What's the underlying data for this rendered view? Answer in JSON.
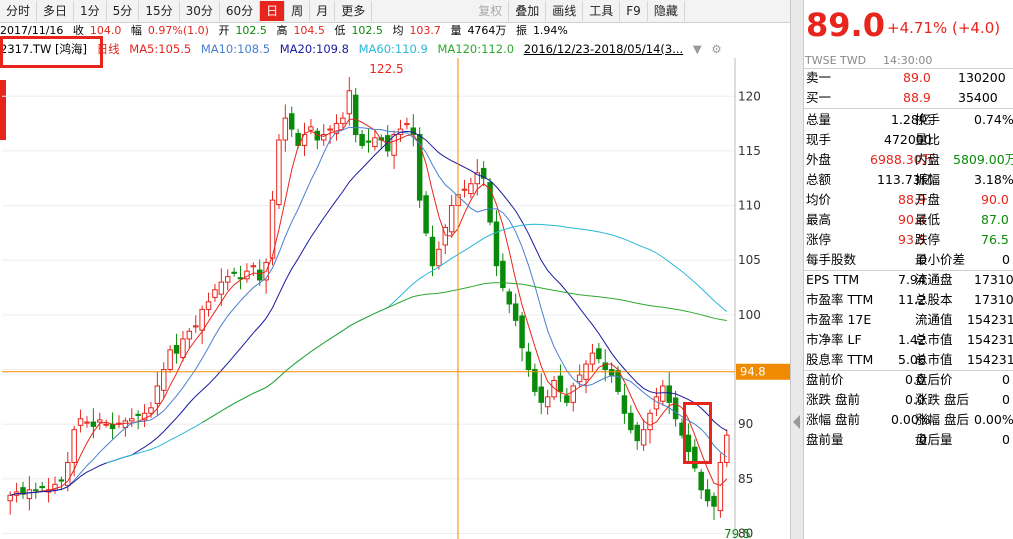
{
  "toolbar": {
    "items": [
      "分时",
      "多日",
      "1分",
      "5分",
      "15分",
      "30分",
      "60分",
      "日",
      "周",
      "月",
      "更多"
    ],
    "active": "日",
    "right": [
      "复权",
      "叠加",
      "画线",
      "工具",
      "F9",
      "隐藏"
    ]
  },
  "ohlc": {
    "date": "2017/11/16",
    "close_label": "收",
    "close": "104.0",
    "range_label": "幅",
    "range": "0.97%(1.0)",
    "open_label": "开",
    "open": "102.5",
    "high_label": "高",
    "high": "104.5",
    "low_label": "低",
    "low": "102.5",
    "avg_label": "均",
    "avg": "103.7",
    "vol_label": "量",
    "vol": "4764万",
    "amp_label": "振",
    "amp": "1.94%"
  },
  "ma_line": {
    "symbol": "2317.TW [鸿海]",
    "period": "日线",
    "ma5": "MA5:105.5",
    "ma10": "MA10:108.5",
    "ma20": "MA20:109.8",
    "ma60": "MA60:110.9",
    "ma120": "MA120:112.0",
    "date_range": "2016/12/23-2018/05/14(3..."
  },
  "chart_data": {
    "type": "candlestick",
    "yaxis_ticks": [
      80,
      85,
      90,
      95,
      100,
      105,
      110,
      115,
      120
    ],
    "ylim": [
      79.5,
      123.5
    ],
    "annotations": {
      "high_label": "122.5",
      "low_label": "79.5",
      "price_line": "94.8"
    },
    "closes": [
      83.5,
      83.8,
      83.6,
      84.0,
      83.9,
      84.2,
      84.0,
      84.5,
      84.8,
      86.5,
      89.5,
      90.5,
      90.2,
      89.8,
      90.4,
      90.0,
      89.6,
      90.1,
      90.3,
      90.5,
      90.8,
      91.0,
      91.5,
      93.5,
      95.0,
      96.8,
      96.5,
      97.8,
      98.5,
      99.0,
      100.5,
      101.2,
      102.3,
      103.0,
      103.5,
      103.8,
      103.3,
      104.0,
      104.5,
      103.2,
      104.8,
      110.5,
      116.0,
      118.0,
      117.0,
      115.5,
      116.5,
      117.2,
      116.0,
      116.5,
      117.0,
      117.5,
      118.0,
      120.5,
      116.5,
      115.5,
      115.8,
      116.2,
      116.0,
      115.0,
      116.5,
      117.0,
      117.5,
      116.5,
      110.5,
      107.5,
      104.5,
      106.0,
      108.0,
      110.0,
      111.0,
      111.5,
      112.0,
      113.0,
      112.5,
      108.5,
      104.5,
      102.5,
      101.0,
      99.5,
      97.0,
      95.0,
      93.0,
      92.0,
      92.5,
      94.0,
      93.0,
      92.0,
      93.5,
      94.5,
      95.5,
      96.5,
      96.0,
      95.0,
      94.5,
      93.0,
      91.0,
      89.5,
      88.5,
      89.5,
      91.0,
      92.5,
      93.5,
      92.0,
      90.5,
      89.0,
      87.5,
      86.0,
      84.0,
      83.0,
      82.5,
      86.5,
      89.0
    ],
    "ma5_end": 105.5,
    "ma10_end": 108.5,
    "ma20_end": 109.8,
    "ma60_end": 110.9,
    "ma120_end": 112.0
  },
  "quote": {
    "price": "89.0",
    "change": "+4.71% (+4.0)",
    "exchange": "TWSE  TWD",
    "time": "14:30:00",
    "ask": {
      "label": "卖一",
      "price": "89.0",
      "vol": "130200"
    },
    "bid": {
      "label": "买一",
      "price": "88.9",
      "vol": "35400"
    },
    "rows": [
      {
        "l1": "总量",
        "v1": "1.28亿",
        "l2": "换手",
        "v2": "0.74%"
      },
      {
        "l1": "现手",
        "v1": "472000",
        "l2": "量比",
        "v2": ""
      },
      {
        "l1": "外盘",
        "v1": "6988.30万",
        "l2": "内盘",
        "v2": "5809.00万"
      },
      {
        "l1": "总额",
        "v1": "113.73亿",
        "l2": "振幅",
        "v2": "3.18%"
      },
      {
        "l1": "均价",
        "v1": "88.9",
        "l2": "开盘",
        "v2": "90.0"
      },
      {
        "l1": "最高",
        "v1": "90.4",
        "l2": "最低",
        "v2": "87.0"
      },
      {
        "l1": "涨停",
        "v1": "93.5",
        "l2": "跌停",
        "v2": "76.5"
      },
      {
        "l1": "每手股数",
        "v1": "0",
        "l2": "最小价差",
        "v2": "0"
      },
      {
        "l1": "EPS TTM",
        "v1": "7.94",
        "l2": "流通盘",
        "v2": "17310"
      },
      {
        "l1": "市盈率 TTM",
        "v1": "11.2",
        "l2": "总股本",
        "v2": "17310"
      },
      {
        "l1": "市盈率 17E",
        "v1": "-",
        "l2": "流通值",
        "v2": "154231"
      },
      {
        "l1": "市净率 LF",
        "v1": "1.42",
        "l2": "总市值",
        "v2": "154231"
      },
      {
        "l1": "股息率 TTM",
        "v1": "5.06",
        "l2": "总市值",
        "v2": "154231"
      },
      {
        "l1": "盘前价",
        "v1": "0.0",
        "l2": "盘后价",
        "v2": "0"
      },
      {
        "l1": "涨跌 盘前",
        "v1": "0.0",
        "l2": "涨跌 盘后",
        "v2": "0"
      },
      {
        "l1": "涨幅 盘前",
        "v1": "0.00%",
        "l2": "涨幅 盘后",
        "v2": "0.00%"
      },
      {
        "l1": "盘前量",
        "v1": "0",
        "l2": "盘后量",
        "v2": "0"
      }
    ]
  },
  "colors": {
    "up": "#e8251c",
    "down": "#0a8a0a",
    "ma5": "#e8251c",
    "ma10": "#4a7fd0",
    "ma20": "#1a1aa0",
    "ma60": "#2bb8d8",
    "ma120": "#2ea82e",
    "hline": "#f08a00"
  }
}
